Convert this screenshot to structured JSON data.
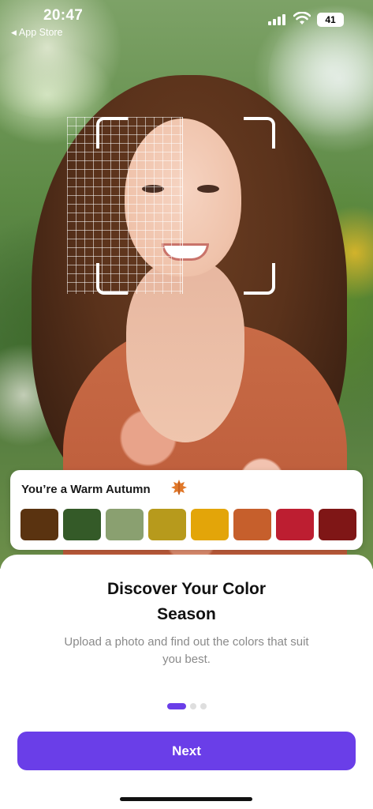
{
  "status_bar": {
    "time": "20:47",
    "back_label": "App Store",
    "battery": "41"
  },
  "palette": {
    "title": "You’re a Warm Autumn",
    "icon": "autumn-leaf-icon",
    "colors": [
      "#5a3310",
      "#345a28",
      "#8aa070",
      "#b79a1c",
      "#e3a509",
      "#c65f2c",
      "#bd1e31",
      "#7f1616"
    ]
  },
  "onboarding": {
    "headline_line1": "Discover Your Color",
    "headline_line2": "Season",
    "description": "Upload a photo and find out the colors that suit you best.",
    "page_total": 3,
    "page_current": 1,
    "next_label": "Next"
  },
  "colors": {
    "accent": "#6a3ee8"
  }
}
